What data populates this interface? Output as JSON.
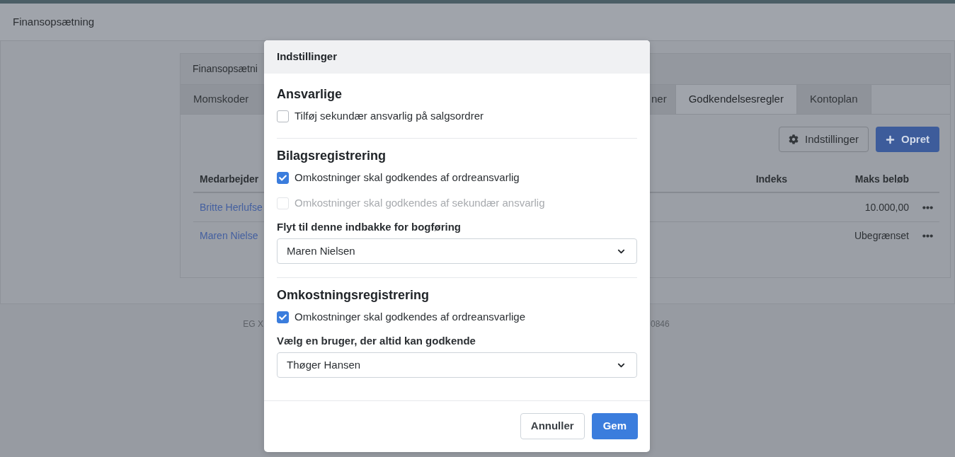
{
  "page": {
    "title": "Finansopsætning"
  },
  "card": {
    "title": "Finansopsætni",
    "tabs": [
      {
        "label": "Momskoder",
        "selected": false
      },
      {
        "label": "ner",
        "selected": false
      },
      {
        "label": "Godkendelsesregler",
        "selected": true
      },
      {
        "label": "Kontoplan",
        "selected": false
      }
    ],
    "toolbar": [
      {
        "label": "Indstillinger",
        "kind": "settings"
      },
      {
        "label": "Opret",
        "kind": "create"
      }
    ],
    "table": {
      "columns": [
        "Medarbejder",
        "Indeks",
        "Maks beløb"
      ],
      "rows": [
        {
          "employee": "Britte Herlufse",
          "max_amount": "10.000,00"
        },
        {
          "employee": "Maren Nielse",
          "max_amount": "Ubegrænset"
        }
      ]
    }
  },
  "footer": {
    "left_text": "EG X",
    "right_text": "0846"
  },
  "dialog": {
    "title": "Indstillinger",
    "sections": [
      {
        "heading": "Ansvarlige",
        "items": [
          {
            "kind": "checkbox",
            "label": "Tilføj sekundær ansvarlig på salgsordrer",
            "checked": false,
            "disabled": false
          }
        ]
      },
      {
        "heading": "Bilagsregistrering",
        "items": [
          {
            "kind": "checkbox",
            "label": "Omkostninger skal godkendes af ordreansvarlig",
            "checked": true,
            "disabled": false
          },
          {
            "kind": "checkbox",
            "label": "Omkostninger skal godkendes af sekundær ansvarlig",
            "checked": false,
            "disabled": true
          },
          {
            "kind": "select",
            "label": "Flyt til denne indbakke for bogføring",
            "value": "Maren Nielsen"
          }
        ]
      },
      {
        "heading": "Omkostningsregistrering",
        "items": [
          {
            "kind": "checkbox",
            "label": "Omkostninger skal godkendes af ordreansvarlige",
            "checked": true,
            "disabled": false
          },
          {
            "kind": "select",
            "label": "Vælg en bruger, der altid kan godkende",
            "value": "Thøger Hansen"
          }
        ]
      }
    ],
    "buttons": [
      {
        "label": "Annuller",
        "kind": "secondary"
      },
      {
        "label": "Gem",
        "kind": "primary"
      }
    ]
  }
}
